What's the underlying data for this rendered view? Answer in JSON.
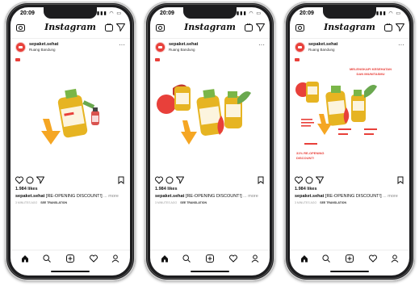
{
  "phones": [
    {
      "time": "20:09",
      "logo": "Instagram",
      "username": "sepaket.sehat",
      "location": "Ruang Bandung",
      "likes": "1.984 likes",
      "caption_user": "sepaket.sehat",
      "caption_text": "[RE-OPENING DISCOUNT!]",
      "caption_more": "... more",
      "meta_time": "3 MINUTES AGO",
      "see_translation": "SEE TRANSLATION"
    },
    {
      "time": "20:09",
      "logo": "Instagram",
      "username": "sepaket.sehat",
      "location": "Ruang Bandung",
      "likes": "1.984 likes",
      "caption_user": "sepaket.sehat",
      "caption_text": "[RE-OPENING DISCOUNT!]",
      "caption_more": "... more",
      "meta_time": "3 MINUTES AGO",
      "see_translation": "SEE TRANSLATION"
    },
    {
      "time": "20:09",
      "logo": "Instagram",
      "username": "sepaket.sehat",
      "location": "Ruang Bandung",
      "likes": "1.984 likes",
      "caption_user": "sepaket.sehat",
      "caption_text": "[RE-OPENING DISCOUNT!]",
      "caption_more": "... more",
      "meta_time": "3 MINUTES AGO",
      "see_translation": "SEE TRANSLATION",
      "post_headline": "MELENGKAPI KESEHATAN DAN IMUNITASMU",
      "post_discount": "31% RE-OPENING DISCOUNT!"
    }
  ],
  "colors": {
    "brand_red": "#e8403a",
    "accent_orange": "#f5a623",
    "accent_green": "#6aa84f",
    "bottle_yellow": "#e6b422"
  },
  "icons": [
    "camera-icon",
    "igtv-icon",
    "direct-message-icon",
    "heart-icon",
    "comment-icon",
    "share-icon",
    "bookmark-icon",
    "home-icon",
    "search-icon",
    "add-post-icon",
    "activity-icon",
    "profile-icon"
  ]
}
